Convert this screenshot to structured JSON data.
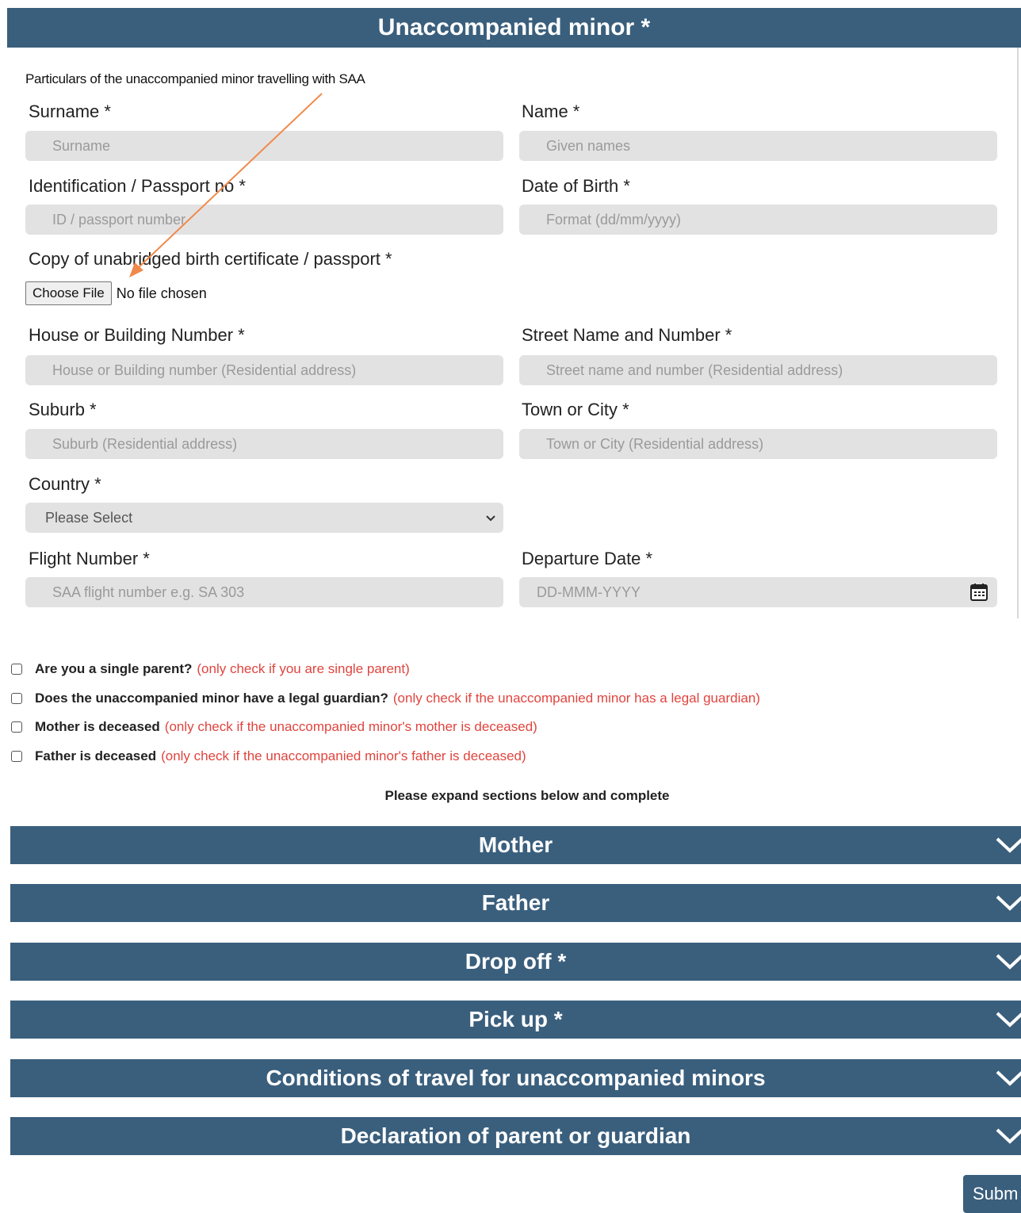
{
  "header": {
    "title": "Unaccompanied minor *"
  },
  "intro": "Particulars of the unaccompanied minor travelling with SAA",
  "fields": {
    "surname": {
      "label": "Surname *",
      "placeholder": "Surname"
    },
    "name": {
      "label": "Name *",
      "placeholder": "Given names"
    },
    "id_passport": {
      "label": "Identification / Passport no *",
      "placeholder": "ID / passport number"
    },
    "dob": {
      "label": "Date of Birth *",
      "placeholder": "Format (dd/mm/yyyy)"
    },
    "birth_cert": {
      "label": "Copy of unabridged birth certificate / passport *",
      "button": "Choose File",
      "status": "No file chosen"
    },
    "house": {
      "label": "House or Building Number *",
      "placeholder": "House or Building number (Residential address)"
    },
    "street": {
      "label": "Street Name and Number *",
      "placeholder": "Street name and number (Residential address)"
    },
    "suburb": {
      "label": "Suburb *",
      "placeholder": "Suburb (Residential address)"
    },
    "town": {
      "label": "Town or City *",
      "placeholder": "Town or City (Residential address)"
    },
    "country": {
      "label": "Country *",
      "selected": "Please Select"
    },
    "flight": {
      "label": "Flight Number *",
      "placeholder": "SAA flight number e.g. SA 303"
    },
    "departure": {
      "label": "Departure Date *",
      "placeholder": "DD-MMM-YYYY"
    }
  },
  "checkboxes": [
    {
      "question": "Are you a single parent?",
      "note": "(only check if you are single parent)",
      "checked": false
    },
    {
      "question": "Does the unaccompanied minor have a legal guardian?",
      "note": "(only check if the unaccompanied minor has a legal guardian)",
      "checked": false
    },
    {
      "question": "Mother is deceased",
      "note": "(only check if the unaccompanied minor's mother is deceased)",
      "checked": false
    },
    {
      "question": "Father is deceased",
      "note": "(only check if the unaccompanied minor's father is deceased)",
      "checked": false
    }
  ],
  "expand_note": "Please expand sections below and complete",
  "sections": [
    {
      "title": "Mother"
    },
    {
      "title": "Father"
    },
    {
      "title": "Drop off *"
    },
    {
      "title": "Pick up *"
    },
    {
      "title": "Conditions of travel for unaccompanied minors"
    },
    {
      "title": "Declaration of parent or guardian"
    }
  ],
  "submit_label": "Subm",
  "colors": {
    "header_bg": "#3a5f7d",
    "field_bg": "#e2e2e2",
    "note_red": "#e0443e",
    "annotation_arrow": "#f08a4b"
  }
}
